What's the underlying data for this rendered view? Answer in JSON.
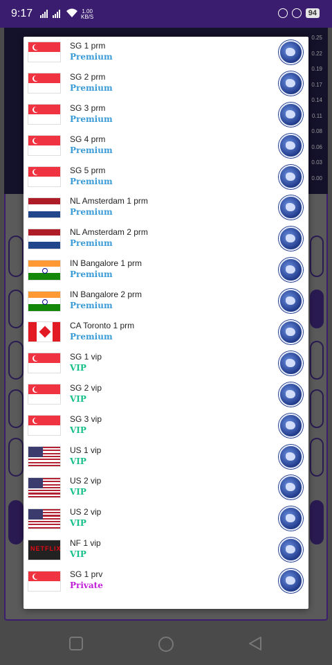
{
  "status_bar": {
    "time": "9:17",
    "net_speed_value": "1.00",
    "net_speed_unit": "KB/S",
    "battery": "94"
  },
  "chart_ticks": [
    "0.25",
    "0.22",
    "0.19",
    "0.17",
    "0.14",
    "0.11",
    "0.08",
    "0.06",
    "0.03",
    "0.00"
  ],
  "tier_colors": {
    "Premium": "#3a9bd6",
    "VIP": "#17c08a",
    "Private": "#c020d8"
  },
  "servers": [
    {
      "name": "SG 1 prm",
      "tier": "Premium",
      "flag": "sg"
    },
    {
      "name": "SG 2 prm",
      "tier": "Premium",
      "flag": "sg"
    },
    {
      "name": "SG 3 prm",
      "tier": "Premium",
      "flag": "sg"
    },
    {
      "name": "SG 4 prm",
      "tier": "Premium",
      "flag": "sg"
    },
    {
      "name": "SG 5 prm",
      "tier": "Premium",
      "flag": "sg"
    },
    {
      "name": "NL Amsterdam 1 prm",
      "tier": "Premium",
      "flag": "nl"
    },
    {
      "name": "NL Amsterdam 2 prm",
      "tier": "Premium",
      "flag": "nl"
    },
    {
      "name": "IN Bangalore 1 prm",
      "tier": "Premium",
      "flag": "in"
    },
    {
      "name": "IN Bangalore 2 prm",
      "tier": "Premium",
      "flag": "in"
    },
    {
      "name": "CA Toronto 1 prm",
      "tier": "Premium",
      "flag": "ca"
    },
    {
      "name": "SG 1 vip",
      "tier": "VIP",
      "flag": "sg"
    },
    {
      "name": "SG 2 vip",
      "tier": "VIP",
      "flag": "sg"
    },
    {
      "name": "SG 3 vip",
      "tier": "VIP",
      "flag": "sg"
    },
    {
      "name": "US 1 vip",
      "tier": "VIP",
      "flag": "us"
    },
    {
      "name": "US 2 vip",
      "tier": "VIP",
      "flag": "us"
    },
    {
      "name": "US 2 vip",
      "tier": "VIP",
      "flag": "us"
    },
    {
      "name": "NF 1 vip",
      "tier": "VIP",
      "flag": "nf",
      "flag_text": "NETFLIX"
    },
    {
      "name": "SG 1 prv",
      "tier": "Private",
      "flag": "sg"
    }
  ]
}
